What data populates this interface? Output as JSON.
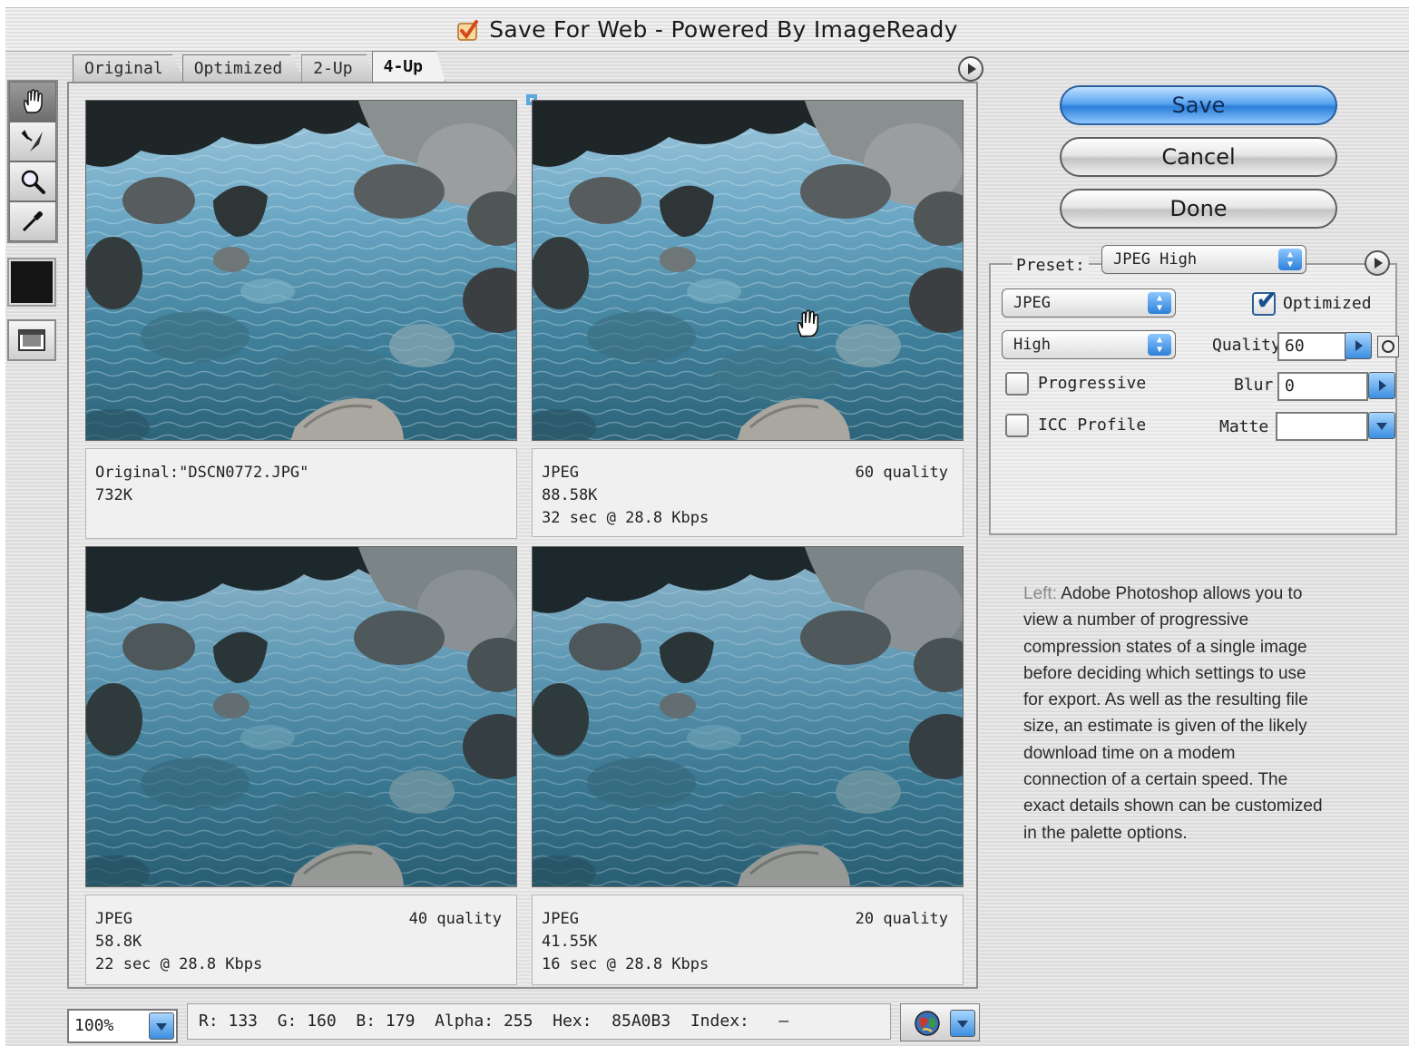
{
  "window": {
    "title": "Save For Web - Powered By ImageReady"
  },
  "tabs": [
    {
      "label": "Original",
      "active": false
    },
    {
      "label": "Optimized",
      "active": false
    },
    {
      "label": "2-Up",
      "active": false
    },
    {
      "label": "4-Up",
      "active": true
    }
  ],
  "tools": [
    "hand-tool-icon",
    "slice-select-tool-icon",
    "zoom-tool-icon",
    "eyedropper-tool-icon"
  ],
  "panes": [
    {
      "line1": "Original:\"DSCN0772.JPG\"",
      "line2": "732K",
      "line3": "",
      "right": "",
      "selected": false
    },
    {
      "line1": "JPEG",
      "line2": "88.58K",
      "line3": "32 sec @ 28.8 Kbps",
      "right": "60 quality",
      "selected": true
    },
    {
      "line1": "JPEG",
      "line2": "58.8K",
      "line3": "22 sec @ 28.8 Kbps",
      "right": "40 quality",
      "selected": false
    },
    {
      "line1": "JPEG",
      "line2": "41.55K",
      "line3": "16 sec @ 28.8 Kbps",
      "right": "20 quality",
      "selected": false
    }
  ],
  "buttons": {
    "save": "Save",
    "cancel": "Cancel",
    "done": "Done"
  },
  "settings": {
    "preset_label": "Preset:",
    "preset_value": "JPEG High",
    "format_value": "JPEG",
    "quality_level_value": "High",
    "optimized_label": "Optimized",
    "optimized_checked": true,
    "quality_label": "Quality",
    "quality_value": "60",
    "progressive_label": "Progressive",
    "progressive_checked": false,
    "blur_label": "Blur",
    "blur_value": "0",
    "icc_label": "ICC Profile",
    "icc_checked": false,
    "matte_label": "Matte",
    "matte_value": ""
  },
  "status": {
    "zoom": "100%",
    "readout": "R: 133  G: 160  B: 179  Alpha: 255  Hex:  85A0B3  Index:   —"
  },
  "caption": {
    "lead": "Left:",
    "text": " Adobe Photoshop allows you to view a number of progressive compression states of a single image before deciding which settings to use for export. As well as the resulting file size, an estimate is given of the likely download time on a modem connection of a certain speed. The exact details shown can be customized in the palette options."
  },
  "colors": {
    "accent_blue": "#5aa7de",
    "save_button": "#2c7fd8",
    "foreground_swatch": "#141414"
  }
}
